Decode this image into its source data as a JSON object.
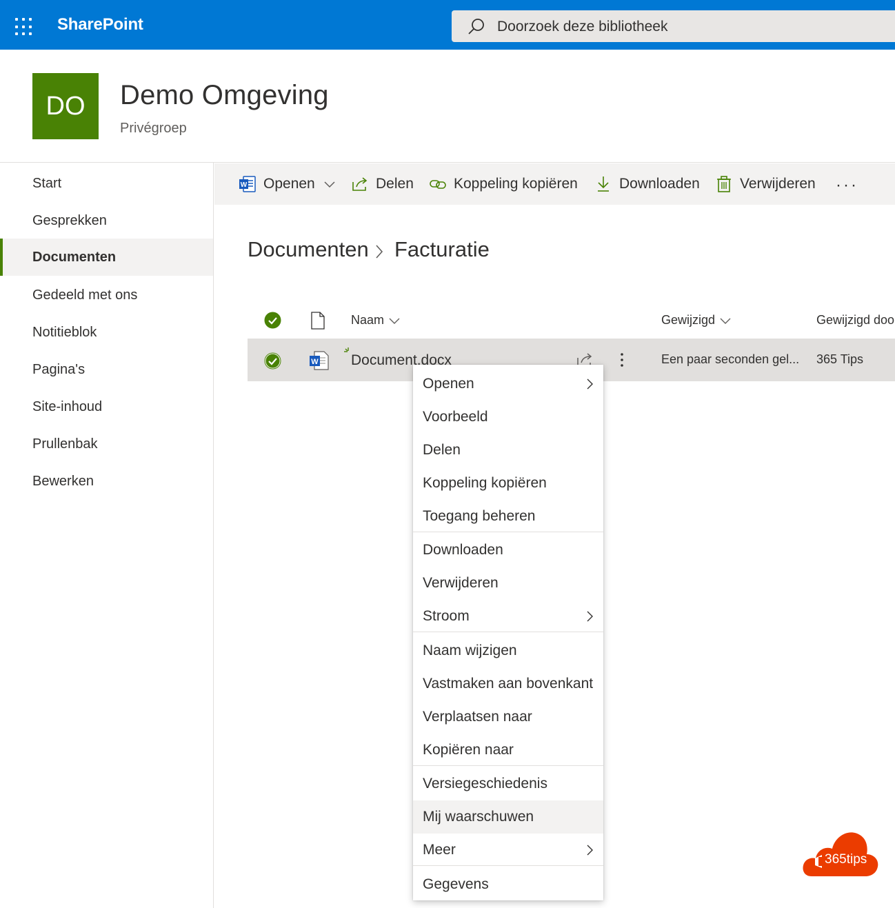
{
  "suite_bar": {
    "app_name": "SharePoint",
    "search_placeholder": "Doorzoek deze bibliotheek",
    "color": "#0078d4"
  },
  "site": {
    "logo_initials": "DO",
    "title": "Demo Omgeving",
    "subtitle": "Privégroep",
    "logo_color": "#498205"
  },
  "nav": {
    "items": [
      {
        "label": "Start"
      },
      {
        "label": "Gesprekken"
      },
      {
        "label": "Documenten",
        "selected": true
      },
      {
        "label": "Gedeeld met ons"
      },
      {
        "label": "Notitieblok"
      },
      {
        "label": "Pagina's"
      },
      {
        "label": "Site-inhoud"
      },
      {
        "label": "Prullenbak"
      },
      {
        "label": "Bewerken"
      }
    ]
  },
  "command_bar": {
    "open": "Openen",
    "share": "Delen",
    "copy_link": "Koppeling kopiëren",
    "download": "Downloaden",
    "delete": "Verwijderen",
    "more": "···"
  },
  "breadcrumb": {
    "root": "Documenten",
    "current": "Facturatie"
  },
  "list": {
    "columns": {
      "name": "Naam",
      "modified": "Gewijzigd",
      "modified_by": "Gewijzigd doo"
    },
    "rows": [
      {
        "name": "Document.docx",
        "modified": "Een paar seconden gel...",
        "modified_by": "365 Tips",
        "selected": true
      }
    ]
  },
  "context_menu": {
    "groups": [
      [
        {
          "label": "Openen",
          "submenu": true
        },
        {
          "label": "Voorbeeld"
        },
        {
          "label": "Delen"
        },
        {
          "label": "Koppeling kopiëren"
        },
        {
          "label": "Toegang beheren"
        }
      ],
      [
        {
          "label": "Downloaden"
        },
        {
          "label": "Verwijderen"
        },
        {
          "label": "Stroom",
          "submenu": true
        }
      ],
      [
        {
          "label": "Naam wijzigen"
        },
        {
          "label": "Vastmaken aan bovenkant"
        },
        {
          "label": "Verplaatsen naar"
        },
        {
          "label": "Kopiëren naar"
        }
      ],
      [
        {
          "label": "Versiegeschiedenis"
        },
        {
          "label": "Mij waarschuwen",
          "hovered": true
        },
        {
          "label": "Meer",
          "submenu": true
        }
      ],
      [
        {
          "label": "Gegevens"
        }
      ]
    ]
  },
  "watermark": {
    "text": "365tips",
    "color": "#eb3c00"
  }
}
